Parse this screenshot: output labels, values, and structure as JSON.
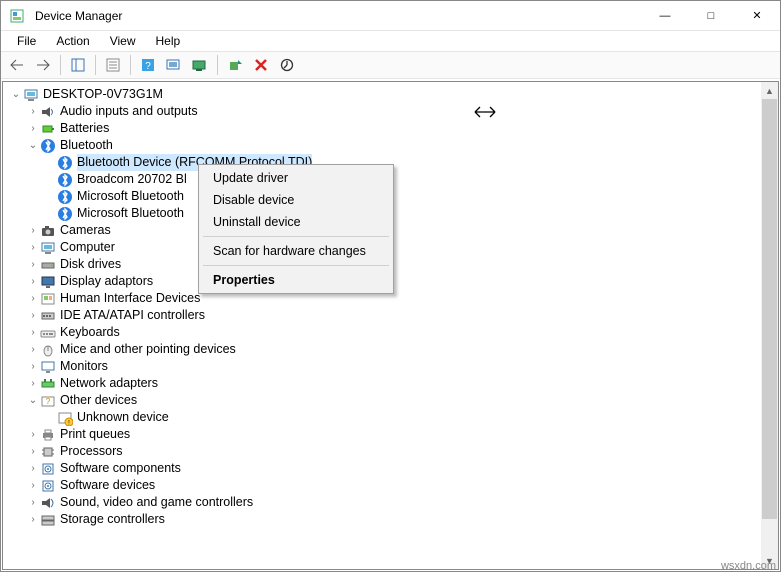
{
  "window": {
    "title": "Device Manager",
    "minimize": "—",
    "maximize": "□",
    "close": "✕"
  },
  "menu": {
    "file": "File",
    "action": "Action",
    "view": "View",
    "help": "Help"
  },
  "tree": {
    "root": "DESKTOP-0V73G1M",
    "items": [
      {
        "label": "Audio inputs and outputs",
        "expand": "›"
      },
      {
        "label": "Batteries",
        "expand": "›"
      },
      {
        "label": "Bluetooth",
        "expand": "⌄",
        "children": [
          {
            "label": "Bluetooth Device (RFCOMM Protocol TDI)",
            "selected": true
          },
          {
            "label": "Broadcom 20702 Bl"
          },
          {
            "label": "Microsoft Bluetooth"
          },
          {
            "label": "Microsoft Bluetooth"
          }
        ]
      },
      {
        "label": "Cameras",
        "expand": "›"
      },
      {
        "label": "Computer",
        "expand": "›"
      },
      {
        "label": "Disk drives",
        "expand": "›"
      },
      {
        "label": "Display adaptors",
        "expand": "›"
      },
      {
        "label": "Human Interface Devices",
        "expand": "›"
      },
      {
        "label": "IDE ATA/ATAPI controllers",
        "expand": "›"
      },
      {
        "label": "Keyboards",
        "expand": "›"
      },
      {
        "label": "Mice and other pointing devices",
        "expand": "›"
      },
      {
        "label": "Monitors",
        "expand": "›"
      },
      {
        "label": "Network adapters",
        "expand": "›"
      },
      {
        "label": "Other devices",
        "expand": "⌄",
        "children": [
          {
            "label": "Unknown device",
            "warn": true
          }
        ]
      },
      {
        "label": "Print queues",
        "expand": "›"
      },
      {
        "label": "Processors",
        "expand": "›"
      },
      {
        "label": "Software components",
        "expand": "›"
      },
      {
        "label": "Software devices",
        "expand": "›"
      },
      {
        "label": "Sound, video and game controllers",
        "expand": "›"
      },
      {
        "label": "Storage controllers",
        "expand": "›"
      }
    ]
  },
  "context_menu": {
    "update": "Update driver",
    "disable": "Disable device",
    "uninstall": "Uninstall device",
    "scan": "Scan for hardware changes",
    "properties": "Properties"
  },
  "watermark": "wsxdn.com"
}
